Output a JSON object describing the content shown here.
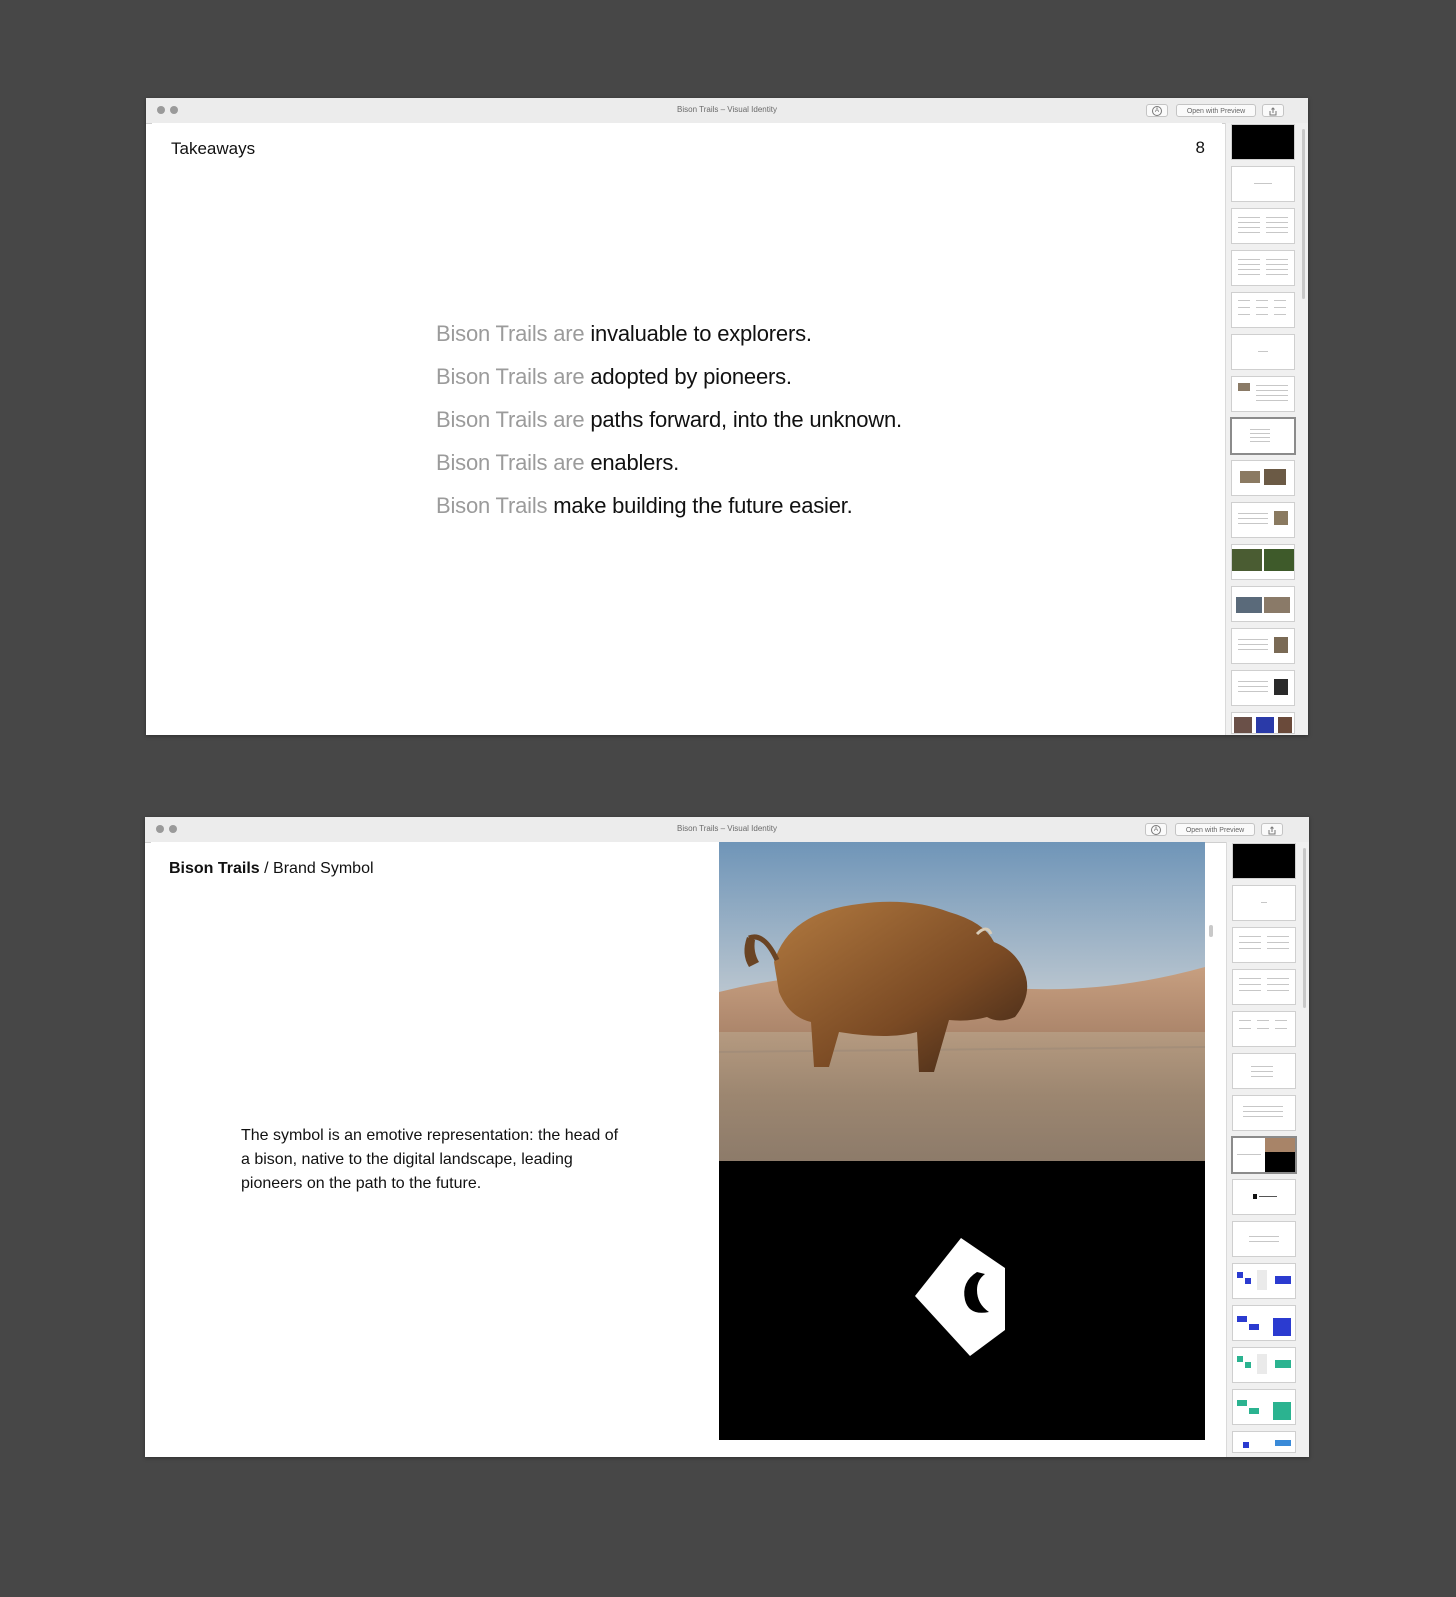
{
  "window_top": {
    "title": "Bison Trails – Visual Identity",
    "open_with_preview": "Open with Preview",
    "slide": {
      "header": "Takeaways",
      "page_number": "8",
      "lines": [
        {
          "grey": "Bison Trails are",
          "black": "invaluable to explorers."
        },
        {
          "grey": "Bison Trails are",
          "black": "adopted by pioneers."
        },
        {
          "grey": "Bison Trails are",
          "black": "paths forward, into the unknown."
        },
        {
          "grey": "Bison Trails are",
          "black": "enablers."
        },
        {
          "grey": "Bison Trails",
          "black": "make building the future easier."
        }
      ]
    }
  },
  "window_bottom": {
    "title": "Bison Trails – Visual Identity",
    "open_with_preview": "Open with Preview",
    "slide": {
      "header_bold": "Bison Trails",
      "header_rest": " / Brand Symbol",
      "body": "The symbol is an emotive representation: the head of a bison, native to the digital landscape, leading pioneers on the path to the future."
    }
  },
  "icons": [
    "close-icon",
    "minimize-icon",
    "markup-icon",
    "share-icon",
    "bison-symbol-icon"
  ],
  "colors": {
    "background": "#474747",
    "grey_text": "#9b9b9b",
    "text": "#111111"
  }
}
